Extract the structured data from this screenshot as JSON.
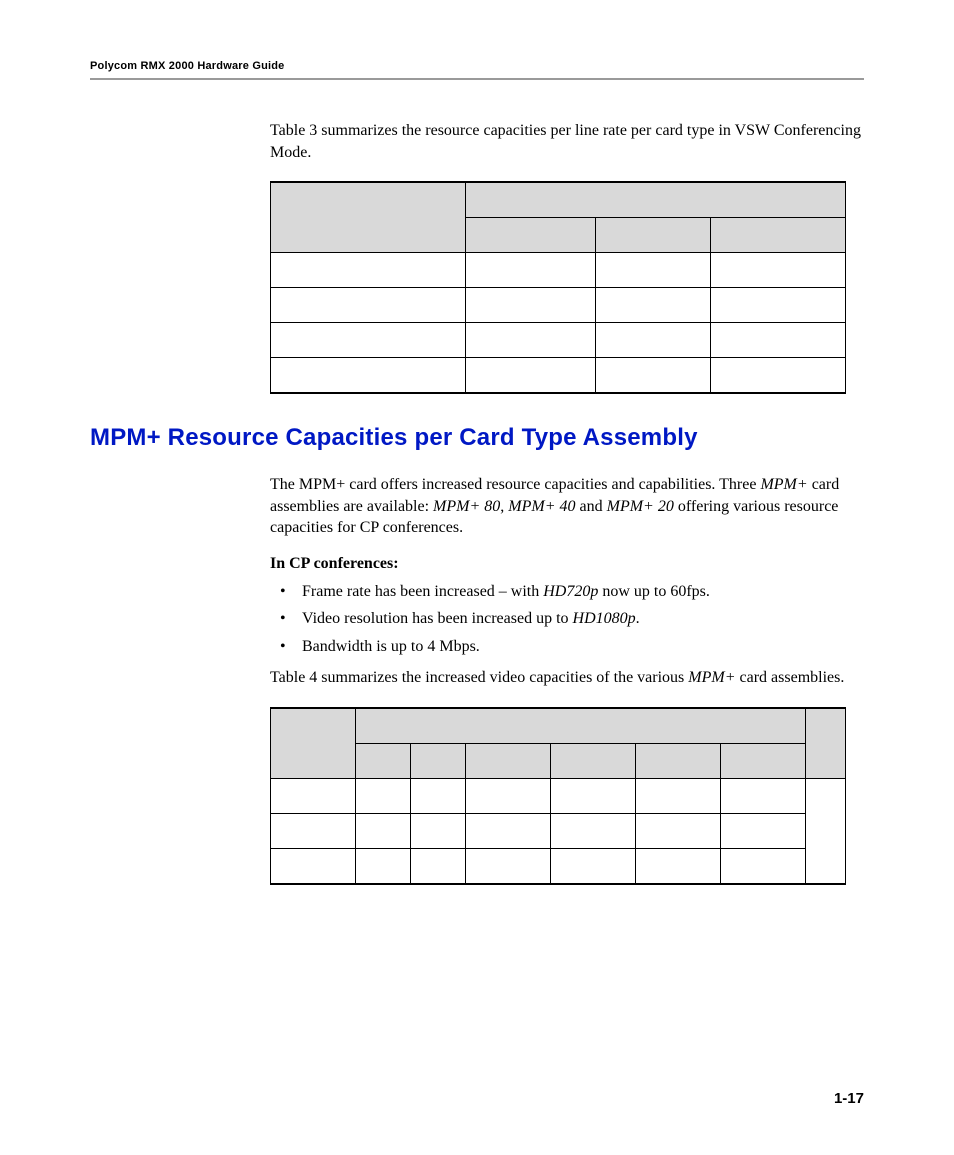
{
  "header": {
    "running_head": "Polycom RMX 2000 Hardware Guide"
  },
  "intro_para": {
    "prefix": "Table 3 summarizes the resource capacities per line rate per card type in VSW Conferencing Mode."
  },
  "table3": {
    "header_span_cols": 3,
    "subheaders": [
      "",
      "",
      ""
    ],
    "rows": [
      [
        "",
        "",
        "",
        ""
      ],
      [
        "",
        "",
        "",
        ""
      ],
      [
        "",
        "",
        "",
        ""
      ],
      [
        "",
        "",
        "",
        ""
      ]
    ]
  },
  "section": {
    "title": "MPM+ Resource Capacities per Card Type Assembly",
    "p1_a": "The MPM+ card offers increased resource capacities and capabilities. Three ",
    "p1_b": "MPM+",
    "p1_c": " card assemblies are available: ",
    "p1_d": "MPM+ 80",
    "p1_e": ", ",
    "p1_f": "MPM+ 40",
    "p1_g": " and ",
    "p1_h": "MPM+ 20",
    "p1_i": " offering various resource capacities for CP conferences.",
    "subhead": "In CP conferences:",
    "bullets": {
      "b1_a": "Frame rate has been increased – with ",
      "b1_b": "HD720p",
      "b1_c": " now up to 60fps.",
      "b2_a": "Video resolution has been increased up to ",
      "b2_b": "HD1080p",
      "b2_c": ".",
      "b3": "Bandwidth is up to 4 Mbps."
    },
    "p2_a": "Table 4 summarizes the increased video capacities of the various ",
    "p2_b": "MPM+",
    "p2_c": " card assemblies."
  },
  "table4": {
    "header_span_cols": 6,
    "subheaders": [
      "",
      "",
      "",
      "",
      "",
      ""
    ],
    "rows": [
      [
        "",
        "",
        "",
        "",
        "",
        "",
        "",
        ""
      ],
      [
        "",
        "",
        "",
        "",
        "",
        "",
        "",
        ""
      ],
      [
        "",
        "",
        "",
        "",
        "",
        "",
        "",
        ""
      ]
    ]
  },
  "footer": {
    "page_number": "1-17"
  }
}
